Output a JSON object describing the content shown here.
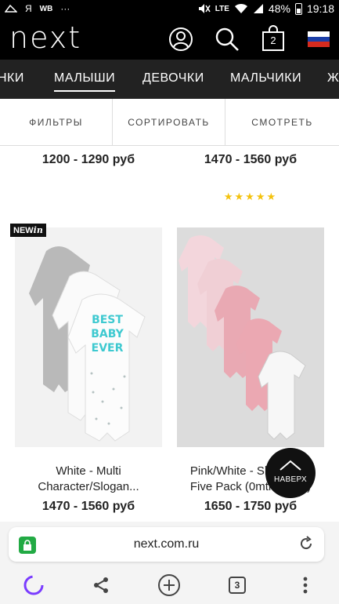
{
  "status_bar": {
    "left_items": [
      "Я",
      "WB",
      "···"
    ],
    "lte": "LTE",
    "battery": "48%",
    "time": "19:18"
  },
  "header": {
    "logo": "next",
    "bag_count": "2",
    "icons": [
      "account-icon",
      "search-icon",
      "bag-icon",
      "russia-flag-icon"
    ]
  },
  "categories": [
    "НКИ",
    "МАЛЫШИ",
    "ДЕВОЧКИ",
    "МАЛЬЧИКИ",
    "Ж"
  ],
  "active_category": "МАЛЫШИ",
  "filter_bar": {
    "filters": "ФИЛЬТРЫ",
    "sort": "СОРТИРОВАТЬ",
    "view": "СМОТРЕТЬ"
  },
  "products_prev_row": [
    {
      "price": "1200 - 1290 руб"
    },
    {
      "price": "1470 - 1560 руб",
      "rating": "★★★★★"
    }
  ],
  "products": [
    {
      "badge_bold": "NEW",
      "badge_italic": "in",
      "title_line1": "White - Multi",
      "title_line2": "Character/Slogan...",
      "price": "1470 - 1560 руб",
      "slogan": "BEST BABY EVER"
    },
    {
      "title_line1": "Pink/White - Sleepsuits",
      "title_line2": "Five Pack (0mths-2yrs)",
      "price": "1650 - 1750 руб"
    }
  ],
  "back_to_top": "НАВЕРХ",
  "browser": {
    "url": "next.com.ru",
    "tabs_count": "3"
  },
  "colors": {
    "header_bg": "#000000",
    "nav_bg": "#222222",
    "star": "#f4c20d",
    "secure": "#22aa44",
    "alice": "#7a3cff"
  }
}
